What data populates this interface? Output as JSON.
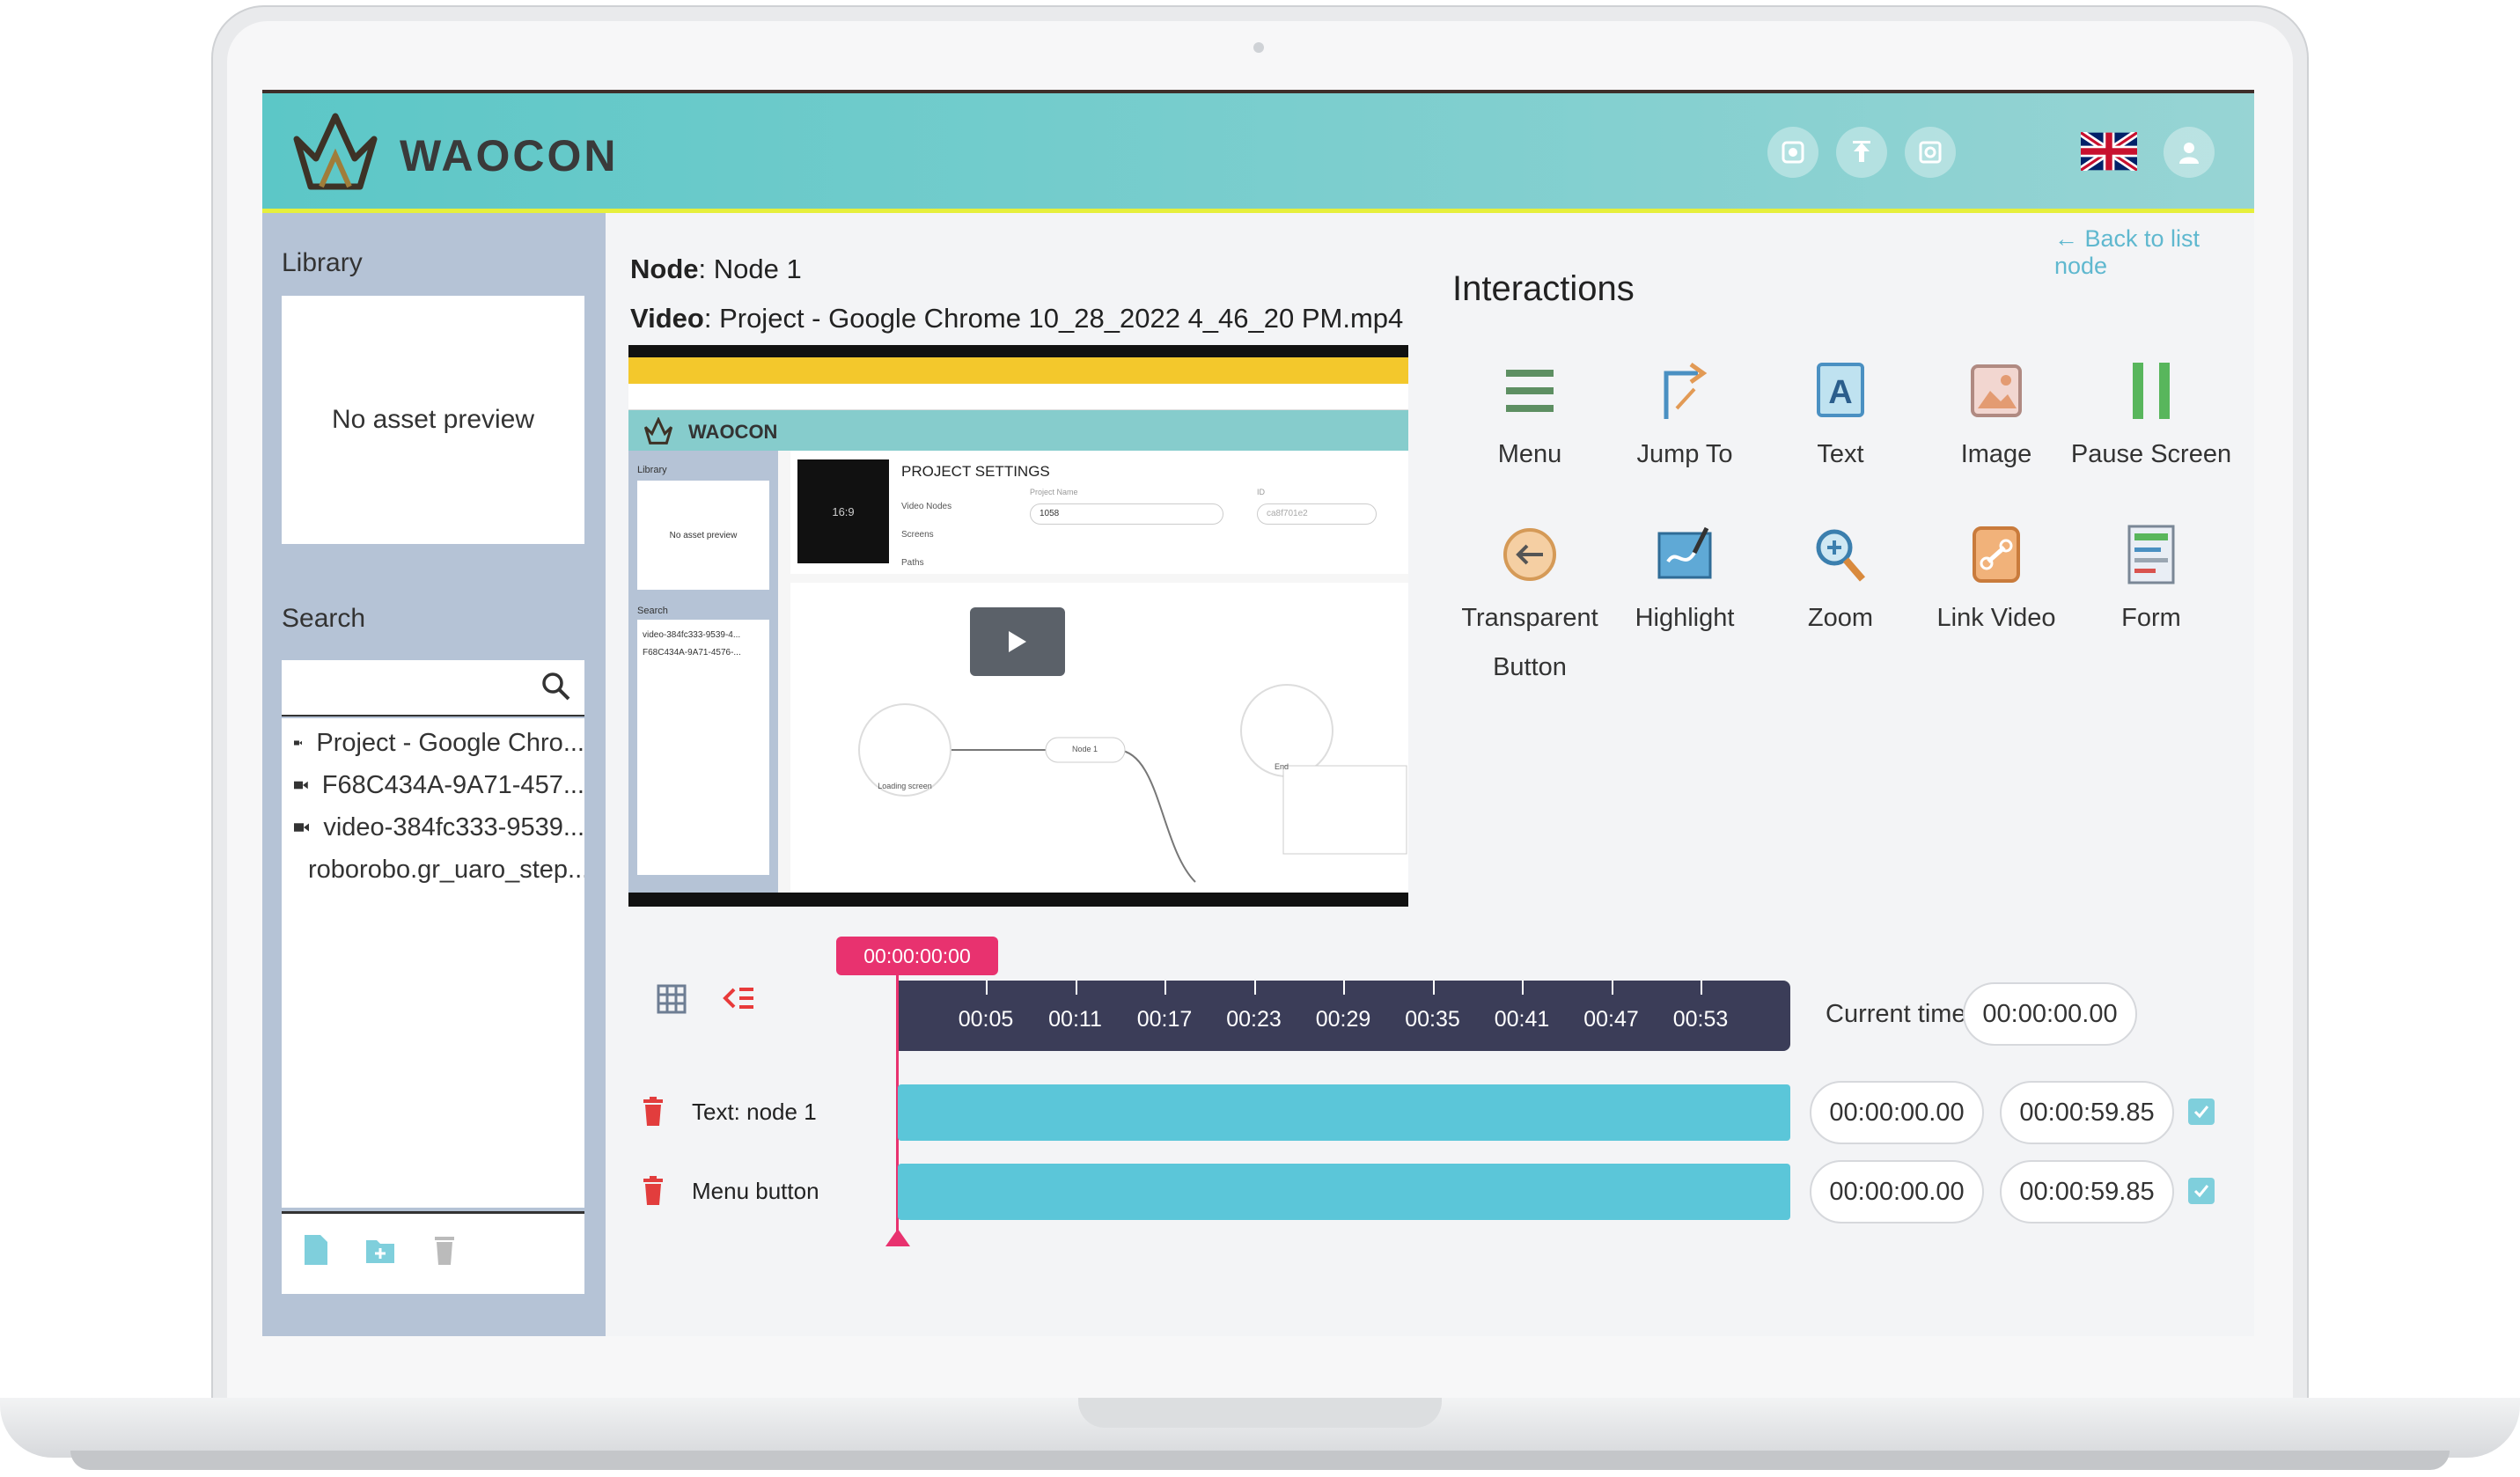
{
  "brand": {
    "name": "WAOCON"
  },
  "header": {
    "buttons": [
      "preview-icon",
      "upload-icon",
      "settings-icon"
    ],
    "language": "en-gb-flag",
    "user": "user-icon"
  },
  "sidebar": {
    "library_title": "Library",
    "preview_text": "No asset preview",
    "search_title": "Search",
    "assets": [
      {
        "icon": "video-icon",
        "name": "Project - Google Chro..."
      },
      {
        "icon": "video-icon",
        "name": "F68C434A-9A71-457..."
      },
      {
        "icon": "video-icon",
        "name": "video-384fc333-9539..."
      },
      {
        "icon": "image-icon",
        "name": "roborobo.gr_uaro_step..."
      }
    ],
    "tools": [
      "new-file-icon",
      "new-folder-icon",
      "delete-icon"
    ]
  },
  "main": {
    "node_label": "Node",
    "node_value": ": Node 1",
    "video_label": "Video",
    "video_value": ": Project - Google Chrome 10_28_2022 4_46_20 PM.mp4",
    "back_link": "Back to list node"
  },
  "video_preview": {
    "app_name": "WAOCON",
    "section_title": "PROJECT SETTINGS",
    "thumb_ratio": "16:9",
    "settings_items": [
      "Video Nodes",
      "Screens",
      "Paths"
    ],
    "project_name_label": "Project Name",
    "project_name_value": "1058",
    "id_label": "ID",
    "id_value": "ca8f701e2",
    "library_label": "Library",
    "preview_text": "No asset preview",
    "search_label": "Search",
    "assets": [
      "video-384fc333-9539-4...",
      "F68C434A-9A71-4576-..."
    ],
    "nodes": [
      "Loading screen",
      "Node 1",
      "End"
    ]
  },
  "interactions": {
    "title": "Interactions",
    "items": [
      {
        "name": "Menu",
        "icon": "menu-icon"
      },
      {
        "name": "Jump To",
        "icon": "jump-to-icon"
      },
      {
        "name": "Text",
        "icon": "text-icon"
      },
      {
        "name": "Image",
        "icon": "image-icon"
      },
      {
        "name": "Pause Screen",
        "icon": "pause-icon"
      },
      {
        "name": "Transparent Button",
        "line1": "Transparent",
        "line2": "Button",
        "icon": "transparent-button-icon"
      },
      {
        "name": "Highlight",
        "icon": "highlight-icon"
      },
      {
        "name": "Zoom",
        "icon": "zoom-icon"
      },
      {
        "name": "Link Video",
        "icon": "link-video-icon"
      },
      {
        "name": "Form",
        "icon": "form-icon"
      }
    ]
  },
  "timeline": {
    "playhead": "00:00:00:00",
    "ticks": [
      "00:05",
      "00:11",
      "00:17",
      "00:23",
      "00:29",
      "00:35",
      "00:41",
      "00:47",
      "00:53"
    ],
    "current_time_label": "Current time",
    "current_time": "00:00:00.00",
    "tracks": [
      {
        "label": "Text: node 1",
        "start": "00:00:00.00",
        "end": "00:00:59.85",
        "checked": true
      },
      {
        "label": "Menu button",
        "start": "00:00:00.00",
        "end": "00:00:59.85",
        "checked": true
      }
    ]
  },
  "colors": {
    "header": "#5cc7c7",
    "accent_line": "#e6ef3c",
    "sidebar": "#b5c3d6",
    "track": "#5bc6d9",
    "ruler": "#3b3d58",
    "playhead": "#e8326f"
  }
}
